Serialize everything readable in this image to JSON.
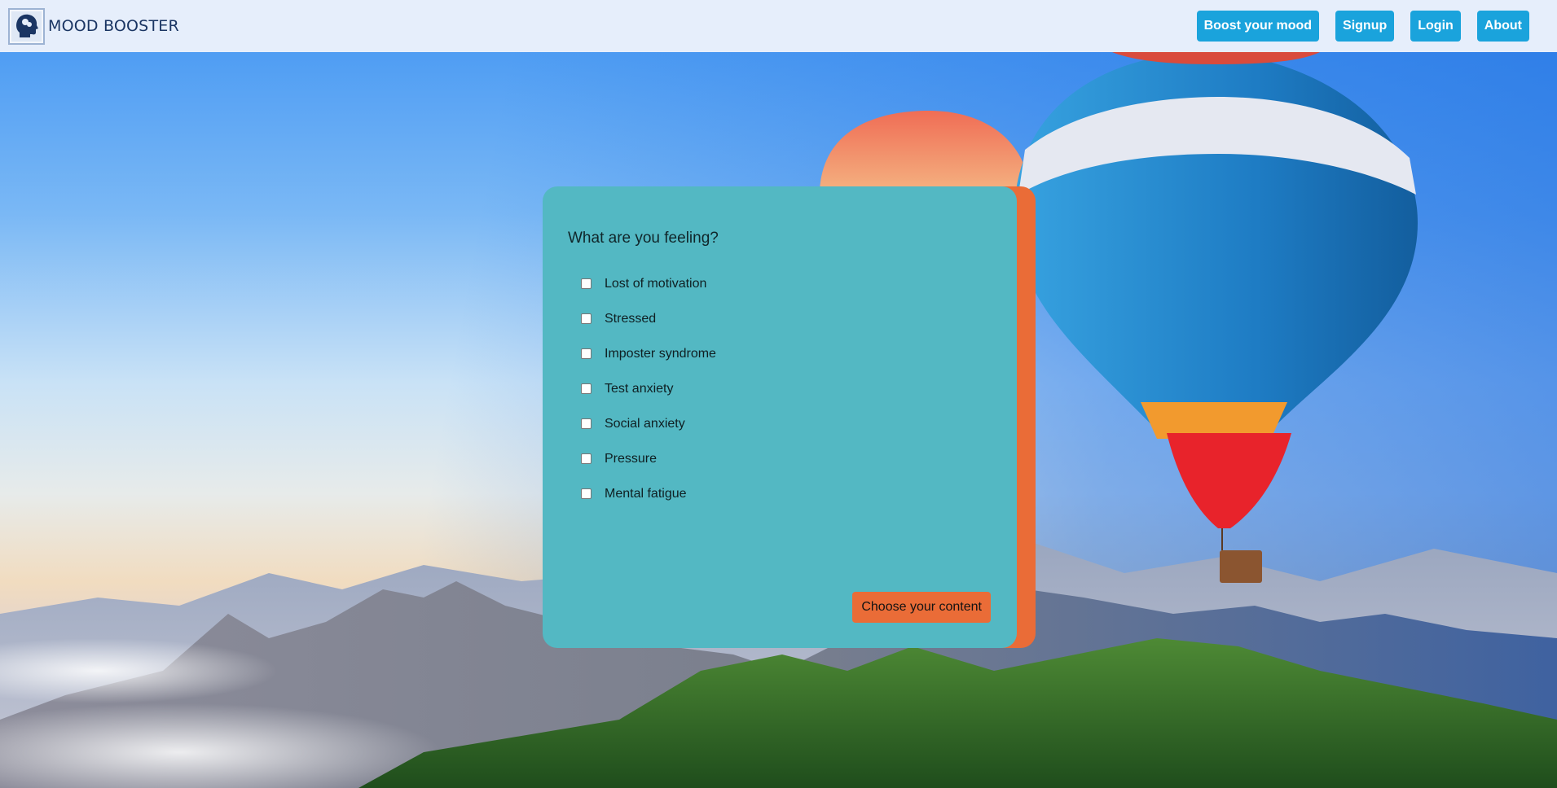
{
  "header": {
    "brand_name": "MOOD BOOSTER",
    "nav": [
      {
        "label": "Boost your mood"
      },
      {
        "label": "Signup"
      },
      {
        "label": "Login"
      },
      {
        "label": "About"
      }
    ]
  },
  "form": {
    "title": "What are you feeling?",
    "options": [
      {
        "label": "Lost of motivation",
        "checked": false
      },
      {
        "label": "Stressed",
        "checked": false
      },
      {
        "label": "Imposter syndrome",
        "checked": false
      },
      {
        "label": "Test anxiety",
        "checked": false
      },
      {
        "label": "Social anxiety",
        "checked": false
      },
      {
        "label": "Pressure",
        "checked": false
      },
      {
        "label": "Mental fatigue",
        "checked": false
      }
    ],
    "submit_label": "Choose your content"
  },
  "colors": {
    "header_bg": "#e6eefb",
    "nav_button": "#1aa3dc",
    "card": "#53b8c3",
    "accent": "#ea6c37",
    "brand_text": "#1a3563"
  },
  "icons": {
    "logo": "head-brain-icon"
  }
}
